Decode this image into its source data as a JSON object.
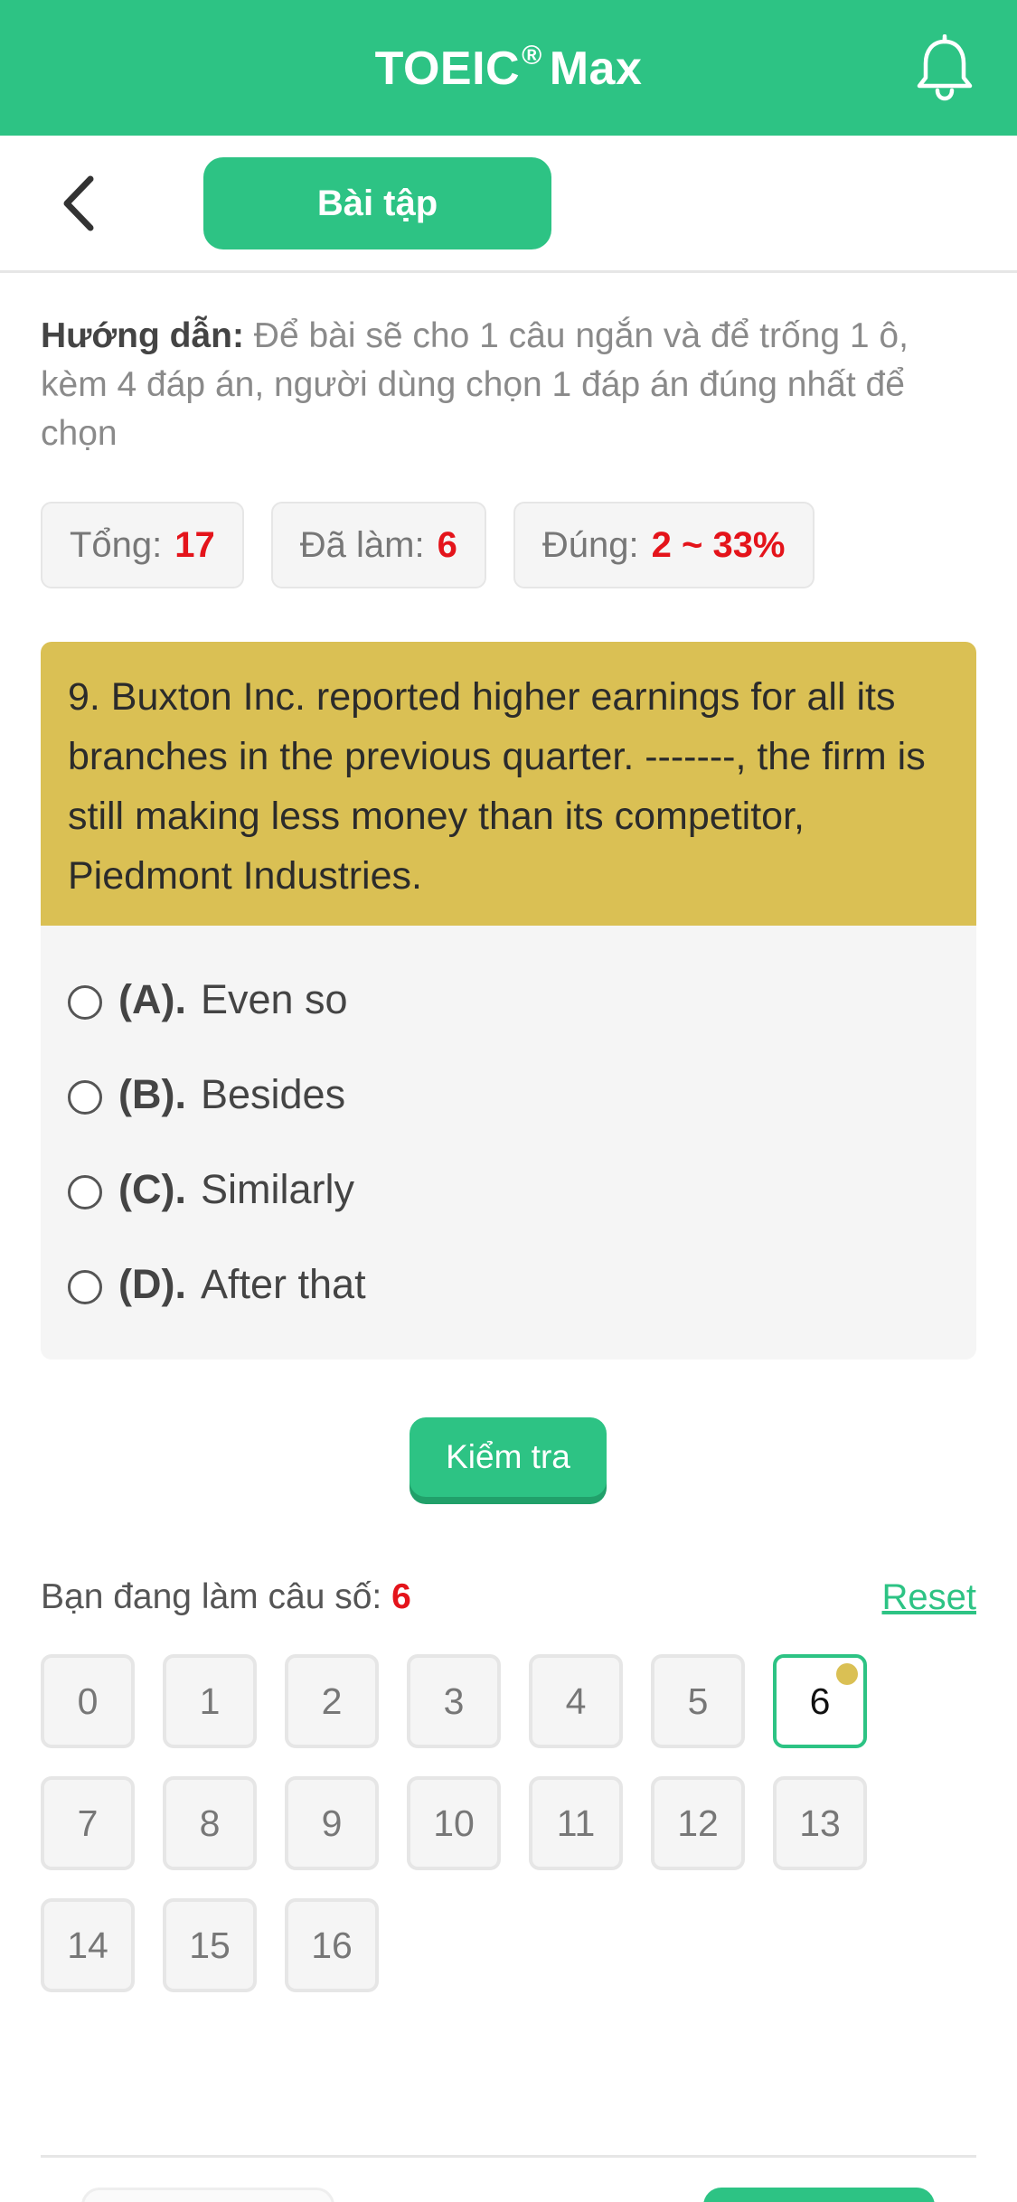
{
  "app": {
    "title": "TOEIC",
    "title_mark": "®",
    "title_suffix": "Max",
    "accent": "#2DC384",
    "icons": [
      "bell-icon",
      "back-chevron-icon"
    ]
  },
  "subbar": {
    "tab_label": "Bài tập"
  },
  "guide": {
    "label": "Hướng dẫn:",
    "text": "Để bài sẽ cho 1 câu ngắn và để trống 1 ô, kèm 4 đáp án, người dùng chọn 1 đáp án đúng nhất để chọn"
  },
  "stats": {
    "total_label": "Tổng:",
    "total_value": "17",
    "done_label": "Đã làm:",
    "done_value": "6",
    "correct_label": "Đúng:",
    "correct_value": "2 ~ 33%"
  },
  "question": {
    "text": "9. Buxton Inc. reported higher earnings for all its branches in the previous quarter. -------, the firm is still making less money than its competitor, Piedmont Industries."
  },
  "options": [
    {
      "letter": "(A).",
      "text": "Even so"
    },
    {
      "letter": "(B).",
      "text": "Besides"
    },
    {
      "letter": "(C).",
      "text": "Similarly"
    },
    {
      "letter": "(D).",
      "text": "After that"
    }
  ],
  "check_button": "Kiểm tra",
  "progress": {
    "label": "Bạn đang làm câu số:",
    "value": "6",
    "reset_label": "Reset"
  },
  "question_numbers": [
    "0",
    "1",
    "2",
    "3",
    "4",
    "5",
    "6",
    "7",
    "8",
    "9",
    "10",
    "11",
    "12",
    "13",
    "14",
    "15",
    "16"
  ],
  "active_question": "6"
}
